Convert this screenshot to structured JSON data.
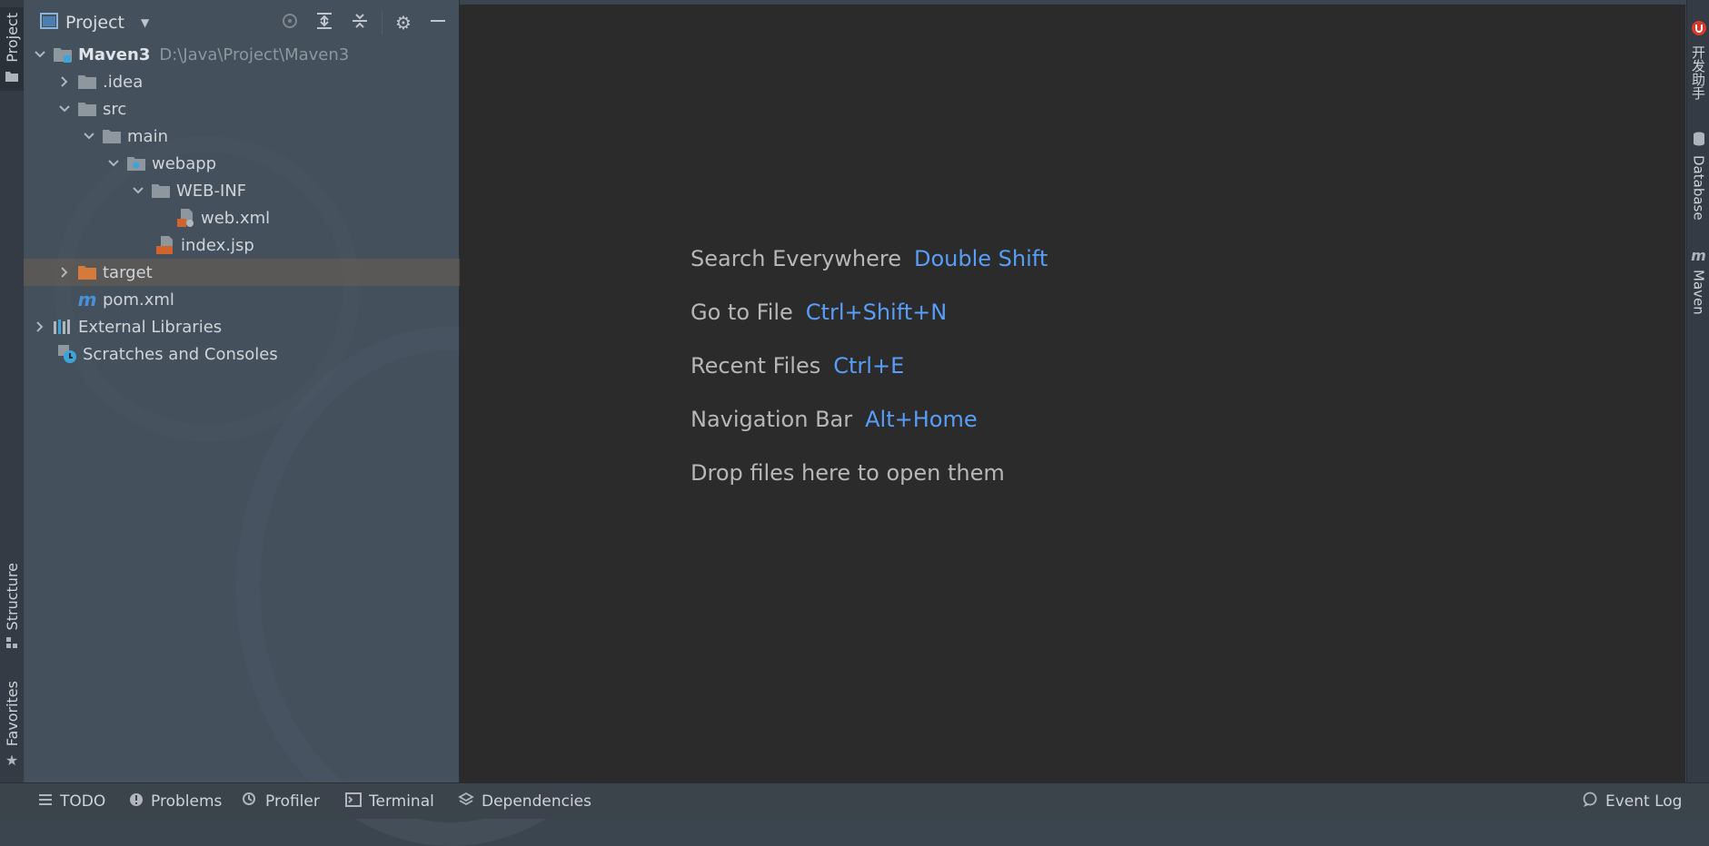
{
  "left_tabs": {
    "project": "Project",
    "structure": "Structure",
    "favorites": "Favorites"
  },
  "right_tabs": {
    "dev_helper": "开发助手",
    "database": "Database",
    "maven": "Maven"
  },
  "panel": {
    "title": "Project"
  },
  "tree": {
    "root_name": "Maven3",
    "root_path": "D:\\Java\\Project\\Maven3",
    "idea": ".idea",
    "src": "src",
    "main": "main",
    "webapp": "webapp",
    "webinf": "WEB-INF",
    "webxml": "web.xml",
    "indexjsp": "index.jsp",
    "target": "target",
    "pom": "pom.xml",
    "ext_libs": "External Libraries",
    "scratches": "Scratches and Consoles"
  },
  "editor_hints": [
    {
      "label": "Search Everywhere",
      "key": "Double Shift"
    },
    {
      "label": "Go to File",
      "key": "Ctrl+Shift+N"
    },
    {
      "label": "Recent Files",
      "key": "Ctrl+E"
    },
    {
      "label": "Navigation Bar",
      "key": "Alt+Home"
    },
    {
      "label": "Drop files here to open them",
      "key": ""
    }
  ],
  "bottom": {
    "todo": "TODO",
    "problems": "Problems",
    "profiler": "Profiler",
    "terminal": "Terminal",
    "dependencies": "Dependencies",
    "event_log": "Event Log"
  },
  "colors": {
    "editor_bg": "#2b2b2b",
    "shortcut_blue": "#589df6",
    "selection": "#6e5f50"
  }
}
